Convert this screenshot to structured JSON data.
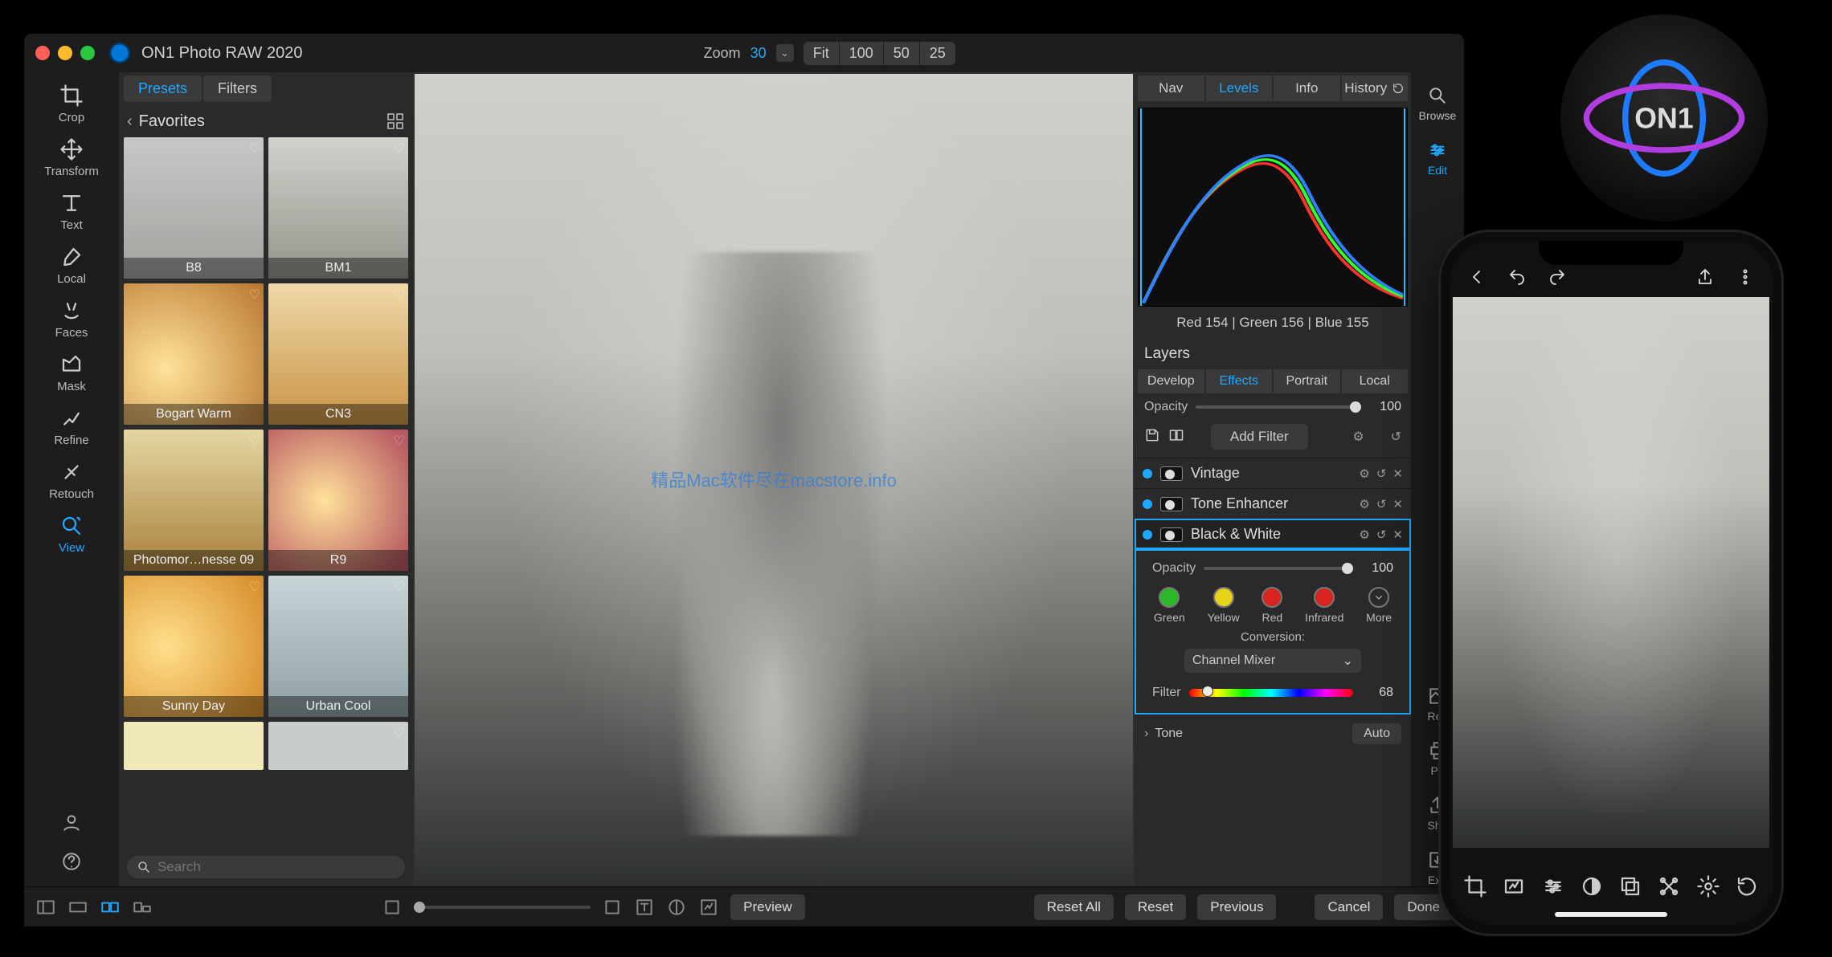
{
  "app": {
    "title": "ON1 Photo RAW 2020"
  },
  "zoom": {
    "label": "Zoom",
    "value": "30",
    "buttons": [
      "Fit",
      "100",
      "50",
      "25"
    ]
  },
  "left_tools": [
    {
      "id": "crop",
      "label": "Crop"
    },
    {
      "id": "transform",
      "label": "Transform"
    },
    {
      "id": "text",
      "label": "Text"
    },
    {
      "id": "local",
      "label": "Local"
    },
    {
      "id": "faces",
      "label": "Faces"
    },
    {
      "id": "mask",
      "label": "Mask"
    },
    {
      "id": "refine",
      "label": "Refine"
    },
    {
      "id": "retouch",
      "label": "Retouch"
    },
    {
      "id": "view",
      "label": "View",
      "active": true
    }
  ],
  "preset_panel": {
    "tabs": [
      "Presets",
      "Filters"
    ],
    "active_tab": "Presets",
    "breadcrumb": "Favorites",
    "thumbs": [
      {
        "id": "b8",
        "label": "B8"
      },
      {
        "id": "bm1",
        "label": "BM1",
        "selected": true
      },
      {
        "id": "bogart",
        "label": "Bogart Warm"
      },
      {
        "id": "cn3",
        "label": "CN3"
      },
      {
        "id": "pm09",
        "label": "Photomor…nesse 09"
      },
      {
        "id": "r9",
        "label": "R9"
      },
      {
        "id": "sunny",
        "label": "Sunny Day"
      },
      {
        "id": "urban",
        "label": "Urban Cool"
      }
    ],
    "search_placeholder": "Search"
  },
  "watermark": "精品Mac软件尽在macstore.info",
  "right_tabs": [
    "Nav",
    "Levels",
    "Info",
    "History"
  ],
  "right_active": "Levels",
  "rgb_readout": "Red 154 | Green 156 | Blue 155",
  "layers_label": "Layers",
  "sub_tabs": [
    "Develop",
    "Effects",
    "Portrait",
    "Local"
  ],
  "sub_active": "Effects",
  "opacity": {
    "label": "Opacity",
    "value": "100"
  },
  "add_filter": "Add Filter",
  "filters": [
    {
      "name": "Vintage"
    },
    {
      "name": "Tone Enhancer"
    },
    {
      "name": "Black & White",
      "selected": true
    }
  ],
  "bw": {
    "opacity_label": "Opacity",
    "opacity_value": "100",
    "colors": [
      {
        "id": "green",
        "label": "Green"
      },
      {
        "id": "yellow",
        "label": "Yellow"
      },
      {
        "id": "red",
        "label": "Red"
      },
      {
        "id": "infrared",
        "label": "Infrared"
      },
      {
        "id": "more",
        "label": "More"
      }
    ],
    "conversion_label": "Conversion:",
    "conversion_value": "Channel Mixer",
    "filter_label": "Filter",
    "filter_value": "68"
  },
  "tone": {
    "label": "Tone",
    "button": "Auto"
  },
  "right_strip": [
    {
      "id": "browse",
      "label": "Browse"
    },
    {
      "id": "edit",
      "label": "Edit",
      "active": true
    },
    {
      "id": "resize",
      "label": "Res"
    },
    {
      "id": "print",
      "label": "Pri"
    },
    {
      "id": "share",
      "label": "Sha"
    },
    {
      "id": "export",
      "label": "Exp"
    }
  ],
  "bottom": {
    "preview": "Preview",
    "reset_all": "Reset All",
    "reset": "Reset",
    "previous": "Previous",
    "cancel": "Cancel",
    "done": "Done"
  },
  "phone": {
    "bottom_icons": [
      "crop",
      "auto",
      "adjust",
      "contrast",
      "layers",
      "ai",
      "settings",
      "undo"
    ]
  }
}
